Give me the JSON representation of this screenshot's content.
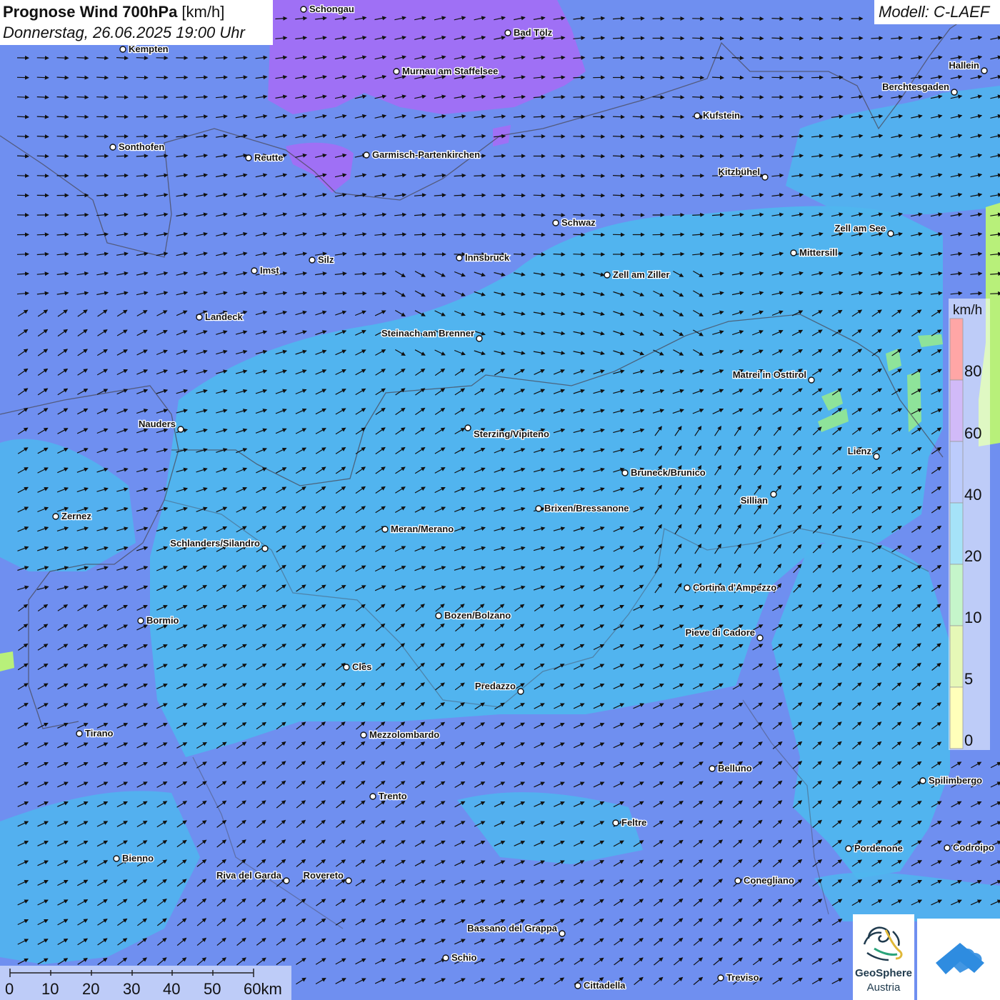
{
  "title": {
    "main": "Prognose Wind 700hPa",
    "unit": " [km/h]",
    "datetime": "Donnerstag, 26.06.2025 19:00 Uhr"
  },
  "model": "Modell: C-LAEF",
  "legend": {
    "unit": "km/h",
    "labels": [
      "80",
      "60",
      "40",
      "20",
      "10",
      "5",
      "0"
    ],
    "colors": [
      "#ff3a3a",
      "#9a66f0",
      "#6a8ef8",
      "#38c0f0",
      "#7ee88a",
      "#c8f060",
      "#ffff66"
    ]
  },
  "scale": {
    "labels": [
      "0",
      "10",
      "20",
      "30",
      "40",
      "50",
      "60km"
    ]
  },
  "logos": {
    "geosphere_line1": "GeoSphere",
    "geosphere_line2": "Austria"
  },
  "map": {
    "wind_direction": "southwest to west",
    "background_color": "#6f8ff0",
    "cities": [
      "Schongau",
      "Bad Tölz",
      "Kempten",
      "Murnau am Staffelsee",
      "Hallein",
      "Berchtesgaden",
      "Kufstein",
      "Sonthofen",
      "Reutte",
      "Garmisch-Partenkirchen",
      "Kitzbühel",
      "Schwaz",
      "Zell am See",
      "Innsbruck",
      "Silz",
      "Mittersill",
      "Imst",
      "Zell am Ziller",
      "Landeck",
      "Steinach am Brenner",
      "Matrei in Osttirol",
      "Nauders",
      "Sterzing/Vipiteno",
      "Lienz",
      "Bruneck/Brunico",
      "Sillian",
      "Brixen/Bressanone",
      "Zernez",
      "Meran/Merano",
      "Schlanders/Silandro",
      "Cortina d'Ampezzo",
      "Bozen/Bolzano",
      "Bormio",
      "Pieve di Cadore",
      "Cles",
      "Predazzo",
      "Tirano",
      "Mezzolombardo",
      "Belluno",
      "Spilimbergo",
      "Trento",
      "Feltre",
      "Pordenone",
      "Codroipo",
      "Bienno",
      "Riva del Garda",
      "Rovereto",
      "Conegliano",
      "Bassano del Grappa",
      "Schio",
      "Treviso",
      "Cittadella"
    ]
  }
}
